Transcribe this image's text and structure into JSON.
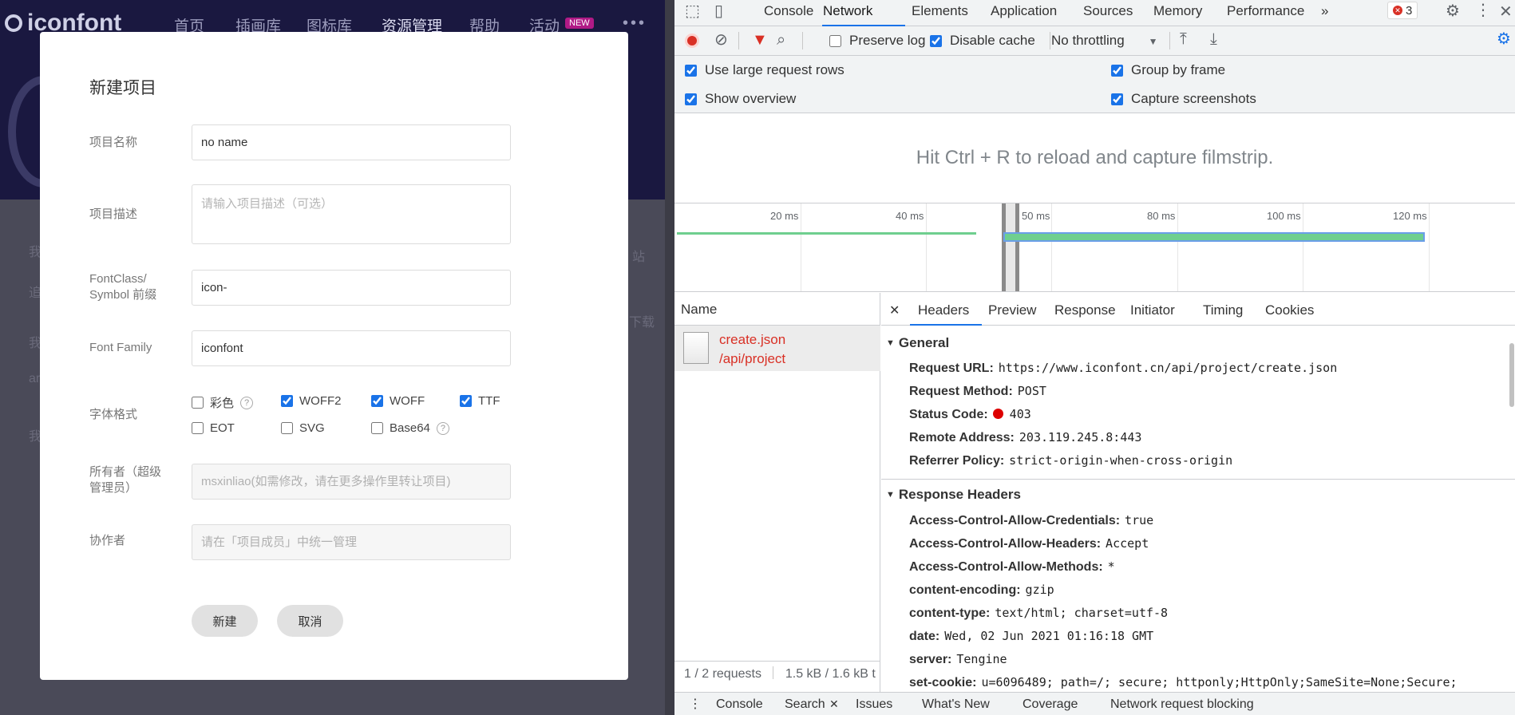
{
  "site": {
    "logo": "iconfont",
    "nav": [
      "首页",
      "插画库",
      "图标库",
      "资源管理",
      "帮助",
      "活动"
    ],
    "nav_badge": "NEW",
    "side_fragments": [
      "我",
      "追",
      "我",
      "ar",
      "我",
      "站",
      "下载"
    ]
  },
  "modal": {
    "title": "新建项目",
    "fields": {
      "name_label": "项目名称",
      "name_value": "no name",
      "desc_label": "项目描述",
      "desc_placeholder": "请输入项目描述（可选）",
      "prefix_label_1": "FontClass/",
      "prefix_label_2": "Symbol 前缀",
      "prefix_value": "icon-",
      "family_label": "Font Family",
      "family_value": "iconfont",
      "format_label": "字体格式",
      "owner_label_1": "所有者（超级",
      "owner_label_2": "管理员）",
      "owner_placeholder": "msxinliao(如需修改，请在更多操作里转让项目)",
      "collab_label": "协作者",
      "collab_placeholder": "请在「项目成员」中统一管理"
    },
    "formats": [
      {
        "label": "彩色",
        "checked": false,
        "help": true
      },
      {
        "label": "WOFF2",
        "checked": true,
        "help": false
      },
      {
        "label": "WOFF",
        "checked": true,
        "help": false
      },
      {
        "label": "TTF",
        "checked": true,
        "help": false
      },
      {
        "label": "EOT",
        "checked": false,
        "help": false
      },
      {
        "label": "SVG",
        "checked": false,
        "help": false
      },
      {
        "label": "Base64",
        "checked": false,
        "help": true
      }
    ],
    "help_glyph": "?",
    "buttons": {
      "create": "新建",
      "cancel": "取消"
    }
  },
  "devtools": {
    "tabs": [
      "Console",
      "Network",
      "Elements",
      "Application",
      "Sources",
      "Memory",
      "Performance"
    ],
    "active_tab": "Network",
    "more_tabs": "»",
    "error_count": "3",
    "toolbar": {
      "preserve_log": "Preserve log",
      "disable_cache": "Disable cache",
      "throttling": "No throttling"
    },
    "options": {
      "large_rows": "Use large request rows",
      "group_by_frame": "Group by frame",
      "show_overview": "Show overview",
      "capture_screenshots": "Capture screenshots"
    },
    "filmstrip_message": "Hit Ctrl + R to reload and capture filmstrip.",
    "timeline_ticks": [
      "20 ms",
      "40 ms",
      "50 ms",
      "80 ms",
      "100 ms",
      "120 ms"
    ],
    "name_header": "Name",
    "request": {
      "file": "create.json",
      "path": "/api/project"
    },
    "footer": {
      "requests": "1 / 2 requests",
      "size": "1.5 kB / 1.6 kB t"
    },
    "detail_tabs": [
      "Headers",
      "Preview",
      "Response",
      "Initiator",
      "Timing",
      "Cookies"
    ],
    "general_title": "General",
    "general": [
      {
        "key": "Request URL:",
        "value": "https://www.iconfont.cn/api/project/create.json"
      },
      {
        "key": "Request Method:",
        "value": "POST"
      },
      {
        "key": "Status Code:",
        "value": "403"
      },
      {
        "key": "Remote Address:",
        "value": "203.119.245.8:443"
      },
      {
        "key": "Referrer Policy:",
        "value": "strict-origin-when-cross-origin"
      }
    ],
    "response_title": "Response Headers",
    "response_headers": [
      {
        "key": "Access-Control-Allow-Credentials:",
        "value": "true"
      },
      {
        "key": "Access-Control-Allow-Headers:",
        "value": "Accept"
      },
      {
        "key": "Access-Control-Allow-Methods:",
        "value": "*"
      },
      {
        "key": "content-encoding:",
        "value": "gzip"
      },
      {
        "key": "content-type:",
        "value": "text/html; charset=utf-8"
      },
      {
        "key": "date:",
        "value": "Wed, 02 Jun 2021 01:16:18 GMT"
      },
      {
        "key": "server:",
        "value": "Tengine"
      },
      {
        "key": "set-cookie:",
        "value": "u=6096489; path=/; secure; httponly;HttpOnly;SameSite=None;Secure;"
      }
    ],
    "drawer_tabs": [
      "Console",
      "Search",
      "Issues",
      "What's New",
      "Coverage",
      "Network request blocking"
    ]
  },
  "colors": {
    "accent": "#1a73e8",
    "error": "#d93025",
    "overlay": "#4a4a58"
  }
}
